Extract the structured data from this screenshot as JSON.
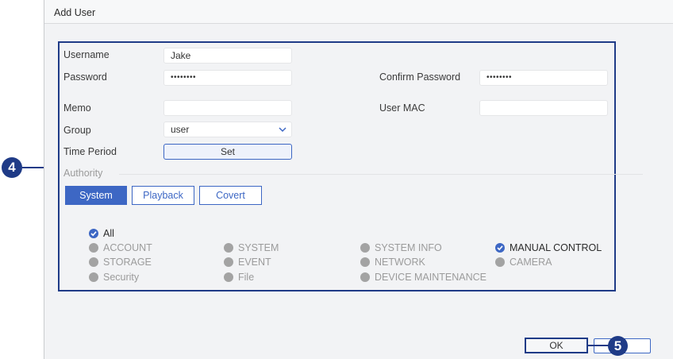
{
  "dialog": {
    "title": "Add User"
  },
  "form": {
    "username": {
      "label": "Username",
      "value": "Jake"
    },
    "password": {
      "label": "Password",
      "value": "••••••••"
    },
    "confirm_password": {
      "label": "Confirm Password",
      "value": "••••••••"
    },
    "memo": {
      "label": "Memo",
      "value": ""
    },
    "user_mac": {
      "label": "User MAC",
      "value": ""
    },
    "group": {
      "label": "Group",
      "value": "user"
    },
    "time_period": {
      "label": "Time Period",
      "button": "Set"
    }
  },
  "authority": {
    "label": "Authority",
    "tabs": [
      {
        "label": "System",
        "active": true
      },
      {
        "label": "Playback",
        "active": false
      },
      {
        "label": "Covert",
        "active": false
      }
    ],
    "all": {
      "label": "All",
      "checked": true
    },
    "permissions": [
      {
        "label": "ACCOUNT",
        "checked": false
      },
      {
        "label": "SYSTEM",
        "checked": false
      },
      {
        "label": "SYSTEM INFO",
        "checked": false
      },
      {
        "label": "MANUAL CONTROL",
        "checked": true
      },
      {
        "label": "STORAGE",
        "checked": false
      },
      {
        "label": "EVENT",
        "checked": false
      },
      {
        "label": "NETWORK",
        "checked": false
      },
      {
        "label": "CAMERA",
        "checked": false
      },
      {
        "label": "Security",
        "checked": false
      },
      {
        "label": "File",
        "checked": false
      },
      {
        "label": "DEVICE MAINTENANCE",
        "checked": false
      }
    ]
  },
  "footer": {
    "ok_label": "OK",
    "cancel_label": ""
  },
  "callouts": {
    "form_callout": "4",
    "ok_callout": "5"
  },
  "colors": {
    "accent": "#3d67c4",
    "callout": "#1f3b87",
    "unchecked": "#a3a3a3"
  }
}
